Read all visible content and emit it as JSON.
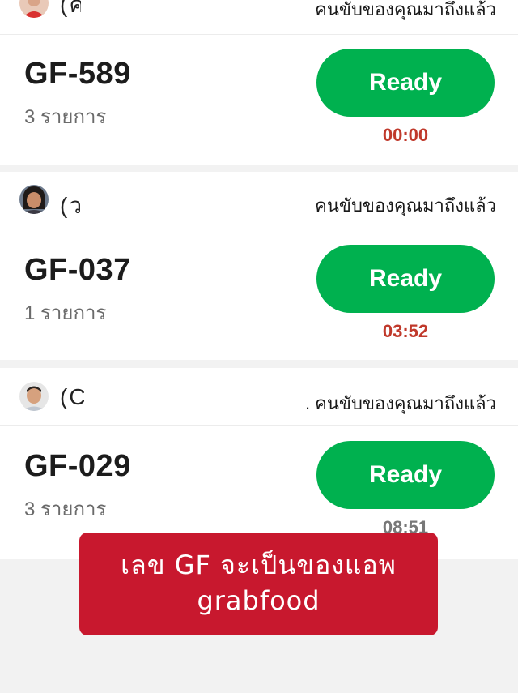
{
  "orders": [
    {
      "driver_name": "(ค",
      "driver_status": "คนขับของคุณมาถึงแล้ว",
      "order_id": "GF-589",
      "item_count": "3 รายการ",
      "button_label": "Ready",
      "timer": "00:00"
    },
    {
      "driver_name": "(ว",
      "driver_status": "คนขับของคุณมาถึงแล้ว",
      "order_id": "GF-037",
      "item_count": "1 รายการ",
      "button_label": "Ready",
      "timer": "03:52"
    },
    {
      "driver_name": "(C",
      "driver_status": ". คนขับของคุณมาถึงแล้ว",
      "order_id": "GF-029",
      "item_count": "3 รายการ",
      "button_label": "Ready",
      "timer": "08:51"
    }
  ],
  "colors": {
    "ready_green": "#00b14f",
    "timer_red": "#c0392b",
    "banner_red": "#c8182e"
  },
  "banner": {
    "line1": "เลข GF จะเป็นของแอพ",
    "line2": "grabfood"
  }
}
